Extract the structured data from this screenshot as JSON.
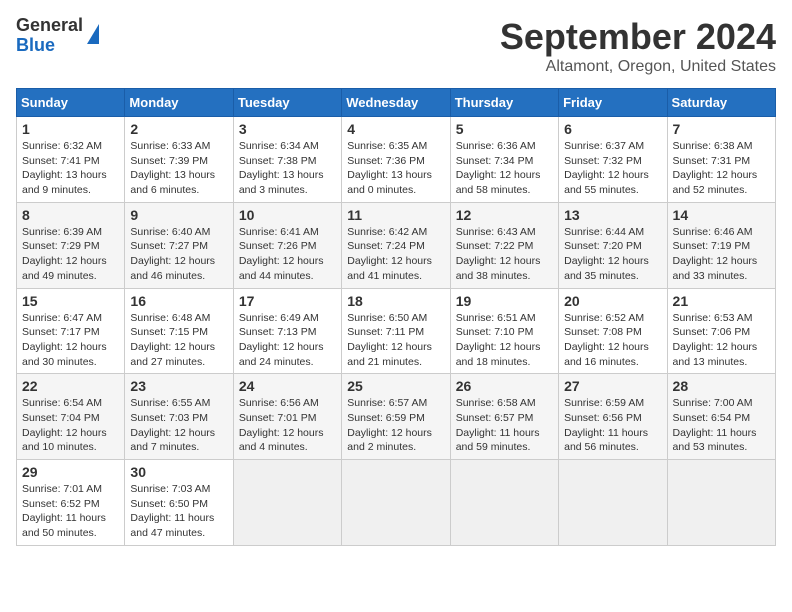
{
  "header": {
    "logo_general": "General",
    "logo_blue": "Blue",
    "month_title": "September 2024",
    "location": "Altamont, Oregon, United States"
  },
  "days_of_week": [
    "Sunday",
    "Monday",
    "Tuesday",
    "Wednesday",
    "Thursday",
    "Friday",
    "Saturday"
  ],
  "weeks": [
    [
      {
        "day": "1",
        "sunrise": "Sunrise: 6:32 AM",
        "sunset": "Sunset: 7:41 PM",
        "daylight": "Daylight: 13 hours and 9 minutes."
      },
      {
        "day": "2",
        "sunrise": "Sunrise: 6:33 AM",
        "sunset": "Sunset: 7:39 PM",
        "daylight": "Daylight: 13 hours and 6 minutes."
      },
      {
        "day": "3",
        "sunrise": "Sunrise: 6:34 AM",
        "sunset": "Sunset: 7:38 PM",
        "daylight": "Daylight: 13 hours and 3 minutes."
      },
      {
        "day": "4",
        "sunrise": "Sunrise: 6:35 AM",
        "sunset": "Sunset: 7:36 PM",
        "daylight": "Daylight: 13 hours and 0 minutes."
      },
      {
        "day": "5",
        "sunrise": "Sunrise: 6:36 AM",
        "sunset": "Sunset: 7:34 PM",
        "daylight": "Daylight: 12 hours and 58 minutes."
      },
      {
        "day": "6",
        "sunrise": "Sunrise: 6:37 AM",
        "sunset": "Sunset: 7:32 PM",
        "daylight": "Daylight: 12 hours and 55 minutes."
      },
      {
        "day": "7",
        "sunrise": "Sunrise: 6:38 AM",
        "sunset": "Sunset: 7:31 PM",
        "daylight": "Daylight: 12 hours and 52 minutes."
      }
    ],
    [
      {
        "day": "8",
        "sunrise": "Sunrise: 6:39 AM",
        "sunset": "Sunset: 7:29 PM",
        "daylight": "Daylight: 12 hours and 49 minutes."
      },
      {
        "day": "9",
        "sunrise": "Sunrise: 6:40 AM",
        "sunset": "Sunset: 7:27 PM",
        "daylight": "Daylight: 12 hours and 46 minutes."
      },
      {
        "day": "10",
        "sunrise": "Sunrise: 6:41 AM",
        "sunset": "Sunset: 7:26 PM",
        "daylight": "Daylight: 12 hours and 44 minutes."
      },
      {
        "day": "11",
        "sunrise": "Sunrise: 6:42 AM",
        "sunset": "Sunset: 7:24 PM",
        "daylight": "Daylight: 12 hours and 41 minutes."
      },
      {
        "day": "12",
        "sunrise": "Sunrise: 6:43 AM",
        "sunset": "Sunset: 7:22 PM",
        "daylight": "Daylight: 12 hours and 38 minutes."
      },
      {
        "day": "13",
        "sunrise": "Sunrise: 6:44 AM",
        "sunset": "Sunset: 7:20 PM",
        "daylight": "Daylight: 12 hours and 35 minutes."
      },
      {
        "day": "14",
        "sunrise": "Sunrise: 6:46 AM",
        "sunset": "Sunset: 7:19 PM",
        "daylight": "Daylight: 12 hours and 33 minutes."
      }
    ],
    [
      {
        "day": "15",
        "sunrise": "Sunrise: 6:47 AM",
        "sunset": "Sunset: 7:17 PM",
        "daylight": "Daylight: 12 hours and 30 minutes."
      },
      {
        "day": "16",
        "sunrise": "Sunrise: 6:48 AM",
        "sunset": "Sunset: 7:15 PM",
        "daylight": "Daylight: 12 hours and 27 minutes."
      },
      {
        "day": "17",
        "sunrise": "Sunrise: 6:49 AM",
        "sunset": "Sunset: 7:13 PM",
        "daylight": "Daylight: 12 hours and 24 minutes."
      },
      {
        "day": "18",
        "sunrise": "Sunrise: 6:50 AM",
        "sunset": "Sunset: 7:11 PM",
        "daylight": "Daylight: 12 hours and 21 minutes."
      },
      {
        "day": "19",
        "sunrise": "Sunrise: 6:51 AM",
        "sunset": "Sunset: 7:10 PM",
        "daylight": "Daylight: 12 hours and 18 minutes."
      },
      {
        "day": "20",
        "sunrise": "Sunrise: 6:52 AM",
        "sunset": "Sunset: 7:08 PM",
        "daylight": "Daylight: 12 hours and 16 minutes."
      },
      {
        "day": "21",
        "sunrise": "Sunrise: 6:53 AM",
        "sunset": "Sunset: 7:06 PM",
        "daylight": "Daylight: 12 hours and 13 minutes."
      }
    ],
    [
      {
        "day": "22",
        "sunrise": "Sunrise: 6:54 AM",
        "sunset": "Sunset: 7:04 PM",
        "daylight": "Daylight: 12 hours and 10 minutes."
      },
      {
        "day": "23",
        "sunrise": "Sunrise: 6:55 AM",
        "sunset": "Sunset: 7:03 PM",
        "daylight": "Daylight: 12 hours and 7 minutes."
      },
      {
        "day": "24",
        "sunrise": "Sunrise: 6:56 AM",
        "sunset": "Sunset: 7:01 PM",
        "daylight": "Daylight: 12 hours and 4 minutes."
      },
      {
        "day": "25",
        "sunrise": "Sunrise: 6:57 AM",
        "sunset": "Sunset: 6:59 PM",
        "daylight": "Daylight: 12 hours and 2 minutes."
      },
      {
        "day": "26",
        "sunrise": "Sunrise: 6:58 AM",
        "sunset": "Sunset: 6:57 PM",
        "daylight": "Daylight: 11 hours and 59 minutes."
      },
      {
        "day": "27",
        "sunrise": "Sunrise: 6:59 AM",
        "sunset": "Sunset: 6:56 PM",
        "daylight": "Daylight: 11 hours and 56 minutes."
      },
      {
        "day": "28",
        "sunrise": "Sunrise: 7:00 AM",
        "sunset": "Sunset: 6:54 PM",
        "daylight": "Daylight: 11 hours and 53 minutes."
      }
    ],
    [
      {
        "day": "29",
        "sunrise": "Sunrise: 7:01 AM",
        "sunset": "Sunset: 6:52 PM",
        "daylight": "Daylight: 11 hours and 50 minutes."
      },
      {
        "day": "30",
        "sunrise": "Sunrise: 7:03 AM",
        "sunset": "Sunset: 6:50 PM",
        "daylight": "Daylight: 11 hours and 47 minutes."
      },
      null,
      null,
      null,
      null,
      null
    ]
  ]
}
